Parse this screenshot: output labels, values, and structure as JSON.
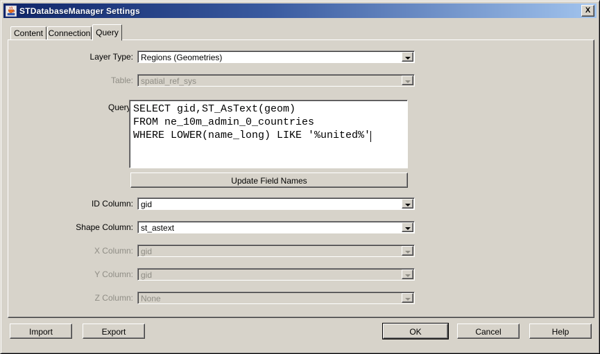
{
  "window": {
    "title": "STDatabaseManager Settings",
    "close_glyph": "X"
  },
  "tabs": [
    {
      "label": "Content",
      "active": false
    },
    {
      "label": "Connection",
      "active": false
    },
    {
      "label": "Query",
      "active": true
    }
  ],
  "form": {
    "layer_type": {
      "label": "Layer Type:",
      "value": "Regions (Geometries)",
      "enabled": true
    },
    "table": {
      "label": "Table:",
      "value": "spatial_ref_sys",
      "enabled": false
    },
    "query": {
      "label": "Query:",
      "value": "SELECT gid,ST_AsText(geom)\nFROM ne_10m_admin_0_countries\nWHERE LOWER(name_long) LIKE '%united%'"
    },
    "update_field_names_button": "Update Field Names",
    "id_column": {
      "label": "ID Column:",
      "value": "gid",
      "enabled": true
    },
    "shape_column": {
      "label": "Shape Column:",
      "value": "st_astext",
      "enabled": true
    },
    "x_column": {
      "label": "X Column:",
      "value": "gid",
      "enabled": false
    },
    "y_column": {
      "label": "Y Column:",
      "value": "gid",
      "enabled": false
    },
    "z_column": {
      "label": "Z Column:",
      "value": "None",
      "enabled": false
    }
  },
  "buttons": {
    "import": "Import",
    "export": "Export",
    "ok": "OK",
    "cancel": "Cancel",
    "help": "Help"
  },
  "colors": {
    "dialog_bg": "#d7d3ca",
    "title_gradient_start": "#0f2569",
    "title_gradient_end": "#a2c4ee",
    "field_bg": "#ffffff",
    "disabled_text": "#8f8d85",
    "shadow_dark": "#404040",
    "shadow_mid": "#848284"
  }
}
